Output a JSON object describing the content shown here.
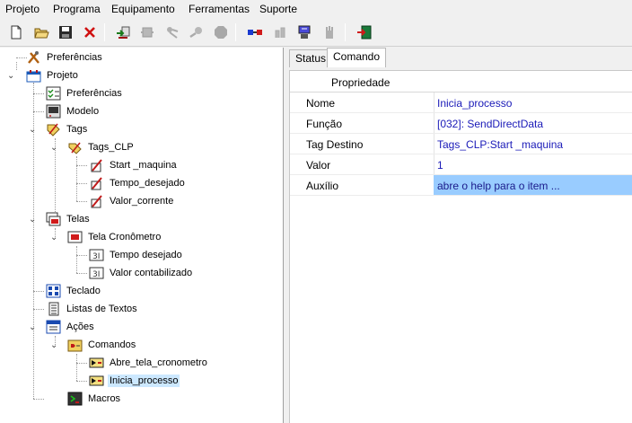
{
  "menubar": [
    "Projeto",
    "Programa",
    "Equipamento",
    "Ferramentas",
    "Suporte"
  ],
  "tree": {
    "preferencias_top": "Preferências",
    "projeto": "Projeto",
    "preferencias": "Preferências",
    "modelo": "Modelo",
    "tags": "Tags",
    "tags_clp": "Tags_CLP",
    "start_maquina": "Start _maquina",
    "tempo_desejado": "Tempo_desejado",
    "valor_corrente": "Valor_corrente",
    "telas": "Telas",
    "tela_cronometro": "Tela Cronômetro",
    "tempo_desejado_ctrl": "Tempo desejado",
    "valor_contabilizado": "Valor contabilizado",
    "teclado": "Teclado",
    "listas_textos": "Listas de Textos",
    "acoes": "Ações",
    "comandos": "Comandos",
    "abre_tela": "Abre_tela_cronometro",
    "inicia_processo": "Inicia_processo",
    "macros": "Macros"
  },
  "tabs": {
    "status": "Status",
    "comando": "Comando"
  },
  "grid": {
    "header": "Propriedade",
    "rows": [
      {
        "key": "Nome",
        "value": "Inicia_processo"
      },
      {
        "key": "Função",
        "value": "[032]: SendDirectData"
      },
      {
        "key": "Tag Destino",
        "value": "Tags_CLP:Start _maquina"
      },
      {
        "key": "Valor",
        "value": "1"
      },
      {
        "key": "Auxílio",
        "value": "abre o help para o item ..."
      }
    ]
  }
}
